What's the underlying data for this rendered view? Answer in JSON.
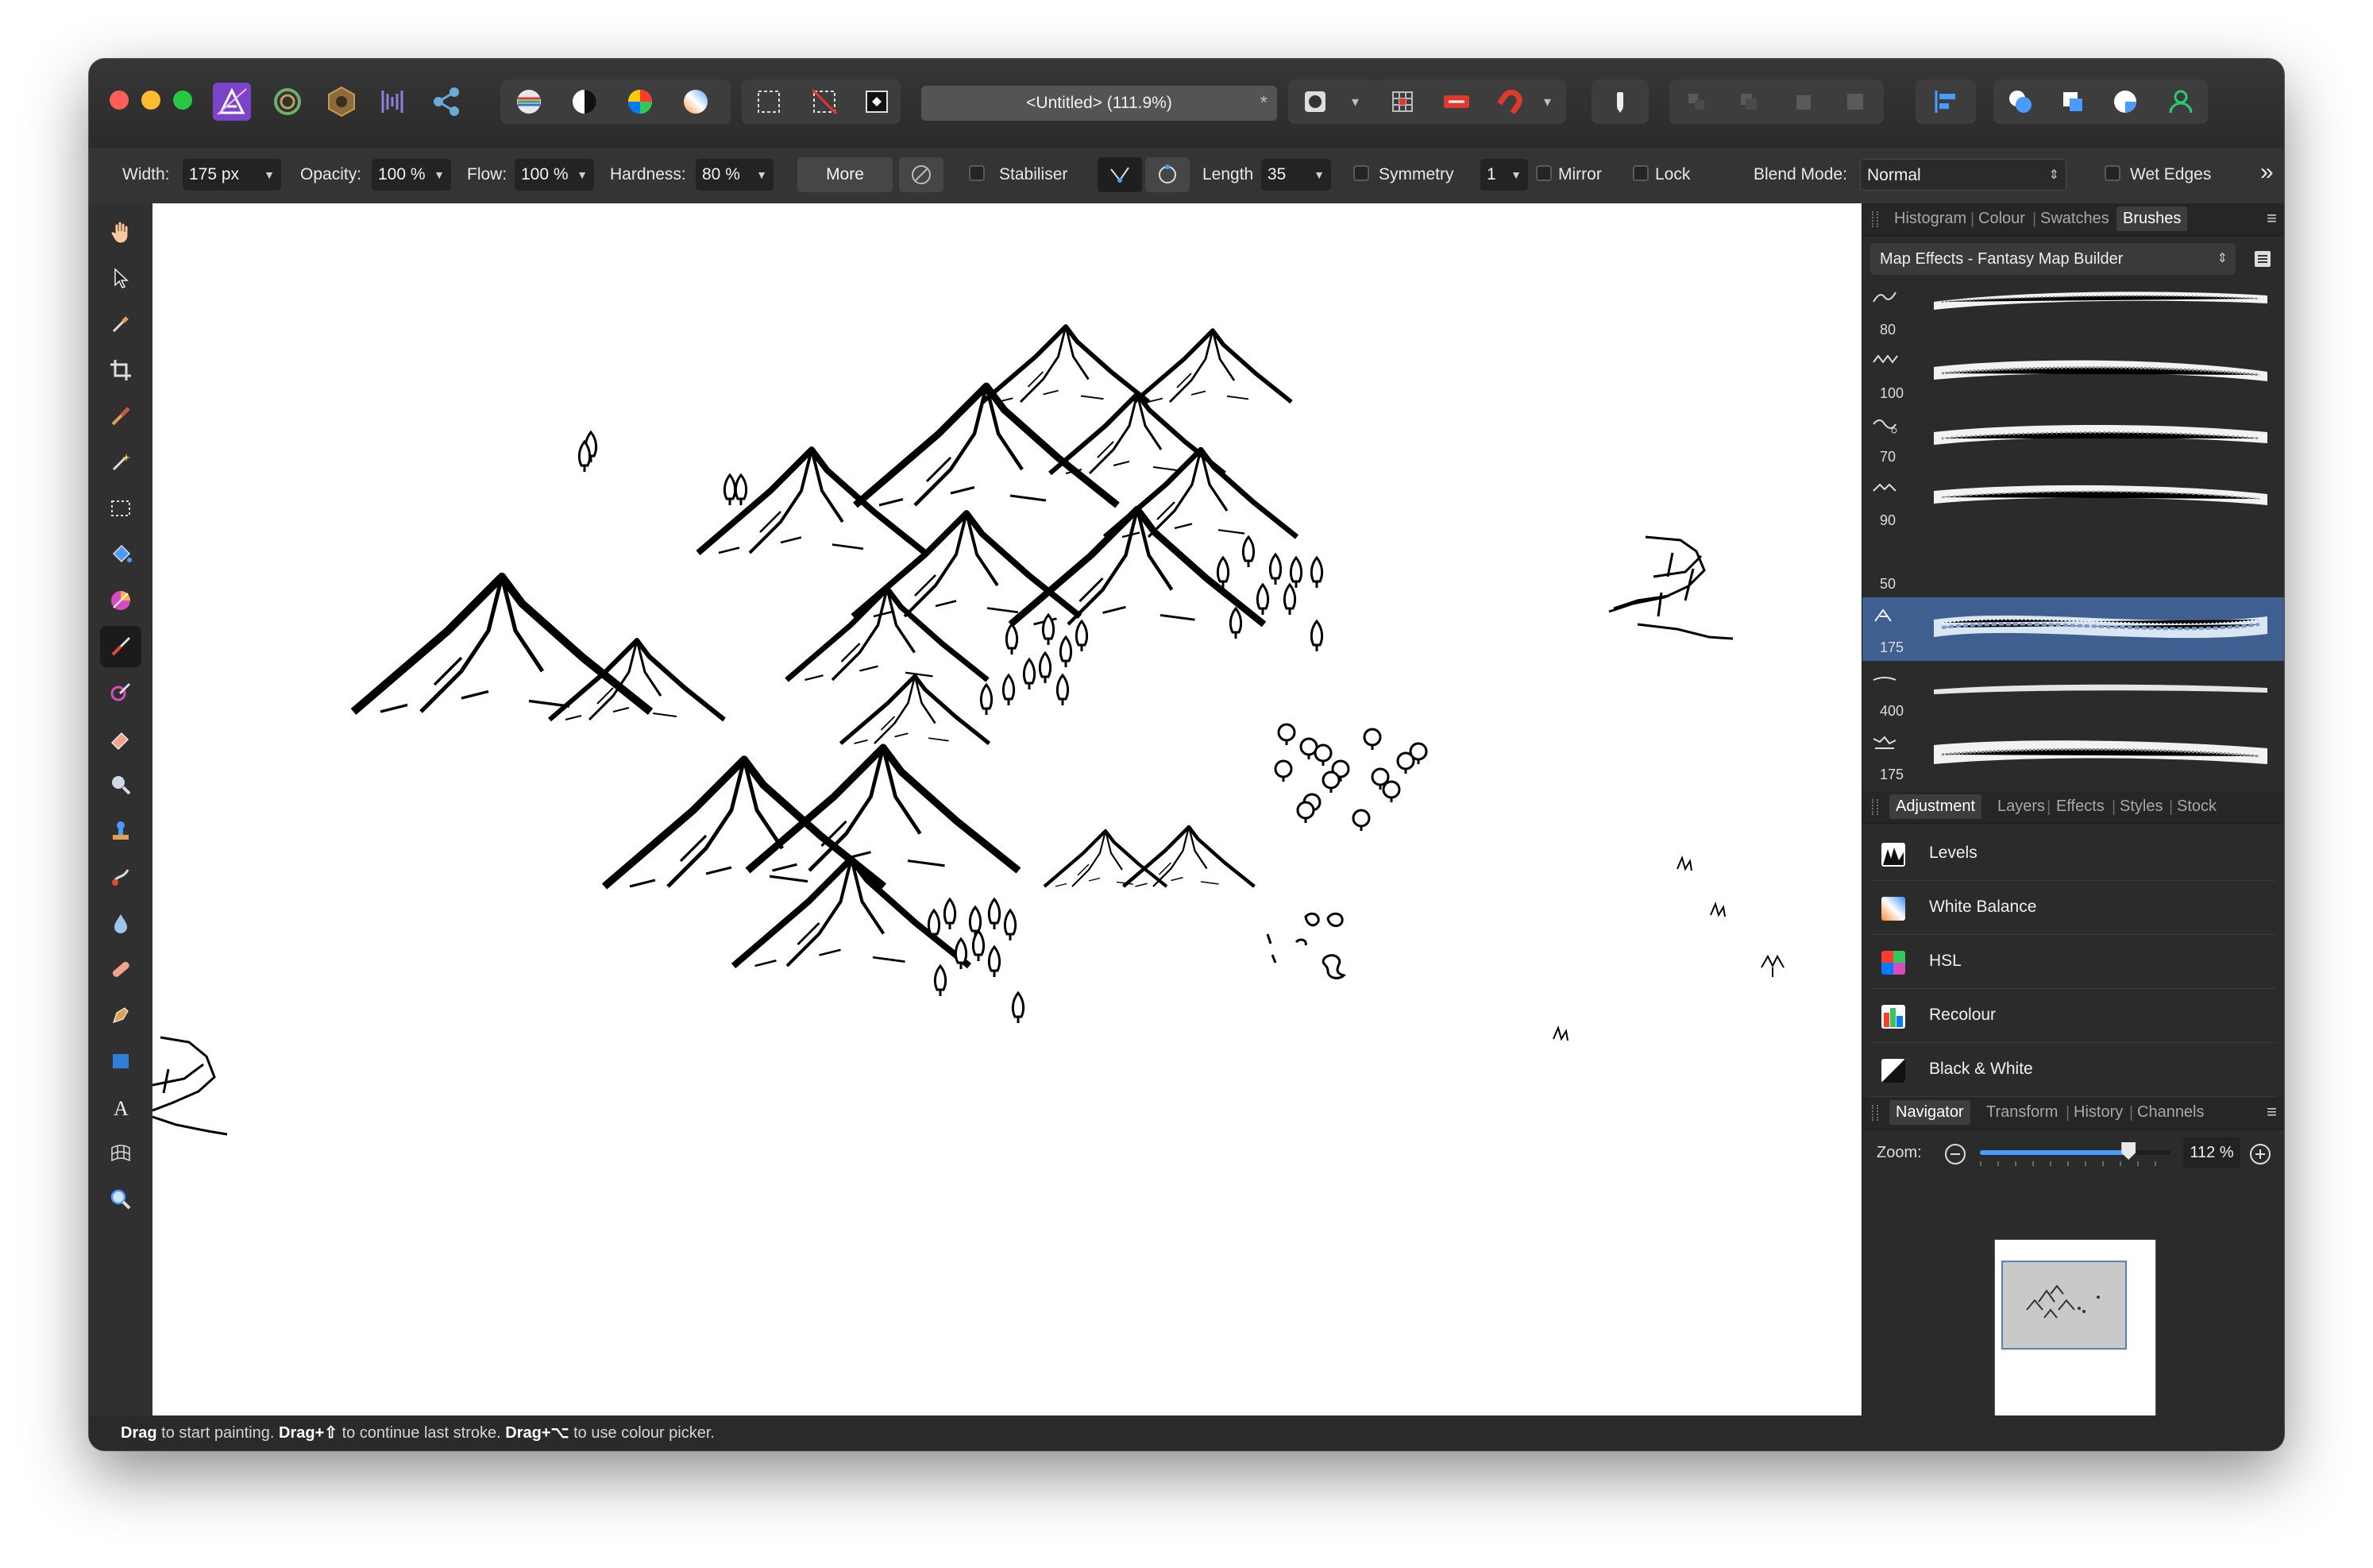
{
  "window": {
    "doc_title": "<Untitled> (111.9%)",
    "doc_close": "*"
  },
  "colors": {
    "close": "#ff5f57",
    "minimize": "#febc2e",
    "zoom": "#28c840",
    "selection": "#3e5f8f",
    "app_icon": "#7b45c9"
  },
  "context_bar": {
    "width_label": "Width:",
    "width_value": "175 px",
    "opacity_label": "Opacity:",
    "opacity_value": "100 %",
    "flow_label": "Flow:",
    "flow_value": "100 %",
    "hardness_label": "Hardness:",
    "hardness_value": "80 %",
    "more_label": "More",
    "stabiliser_label": "Stabiliser",
    "length_label": "Length",
    "length_value": "35",
    "symmetry_label": "Symmetry",
    "symmetry_value": "1",
    "mirror_label": "Mirror",
    "lock_label": "Lock",
    "blend_label": "Blend Mode:",
    "blend_value": "Normal",
    "wet_edges_label": "Wet Edges",
    "overflow": "»"
  },
  "tools": [
    "hand-tool",
    "move-tool",
    "color-picker-tool",
    "crop-tool",
    "paint-brush-tool",
    "selection-brush-tool",
    "marquee-tool",
    "flood-fill-tool",
    "gradient-tool",
    "brush-tool",
    "color-replace-tool",
    "erase-tool",
    "dodge-tool",
    "clone-tool",
    "smudge-tool",
    "blur-tool",
    "healing-tool",
    "pen-tool",
    "rectangle-tool",
    "text-tool",
    "mesh-warp-tool",
    "zoom-tool"
  ],
  "brushes_panel": {
    "tabs": [
      "Histogram",
      "Colour",
      "Swatches",
      "Brushes"
    ],
    "active_tab": "Brushes",
    "category": "Map Effects - Fantasy Map Builder",
    "brushes": [
      {
        "size": "80"
      },
      {
        "size": "100"
      },
      {
        "size": "70"
      },
      {
        "size": "90"
      },
      {
        "size": "50"
      },
      {
        "size": "175",
        "selected": true
      },
      {
        "size": "400"
      },
      {
        "size": "175"
      }
    ]
  },
  "adjustment_panel": {
    "tabs": [
      "Adjustment",
      "Layers",
      "Effects",
      "Styles",
      "Stock"
    ],
    "items": [
      "Levels",
      "White Balance",
      "HSL",
      "Recolour",
      "Black & White"
    ]
  },
  "navigator_panel": {
    "tabs": [
      "Navigator",
      "Transform",
      "History",
      "Channels"
    ],
    "zoom_label": "Zoom:",
    "zoom_value": "112 %",
    "zoom_level": 0.78
  },
  "status": {
    "drag1": "Drag",
    "text1": " to start painting. ",
    "drag2": "Drag+⇧",
    "text2": " to continue last stroke. ",
    "drag3": "Drag+⌥",
    "text3": " to use colour picker."
  }
}
